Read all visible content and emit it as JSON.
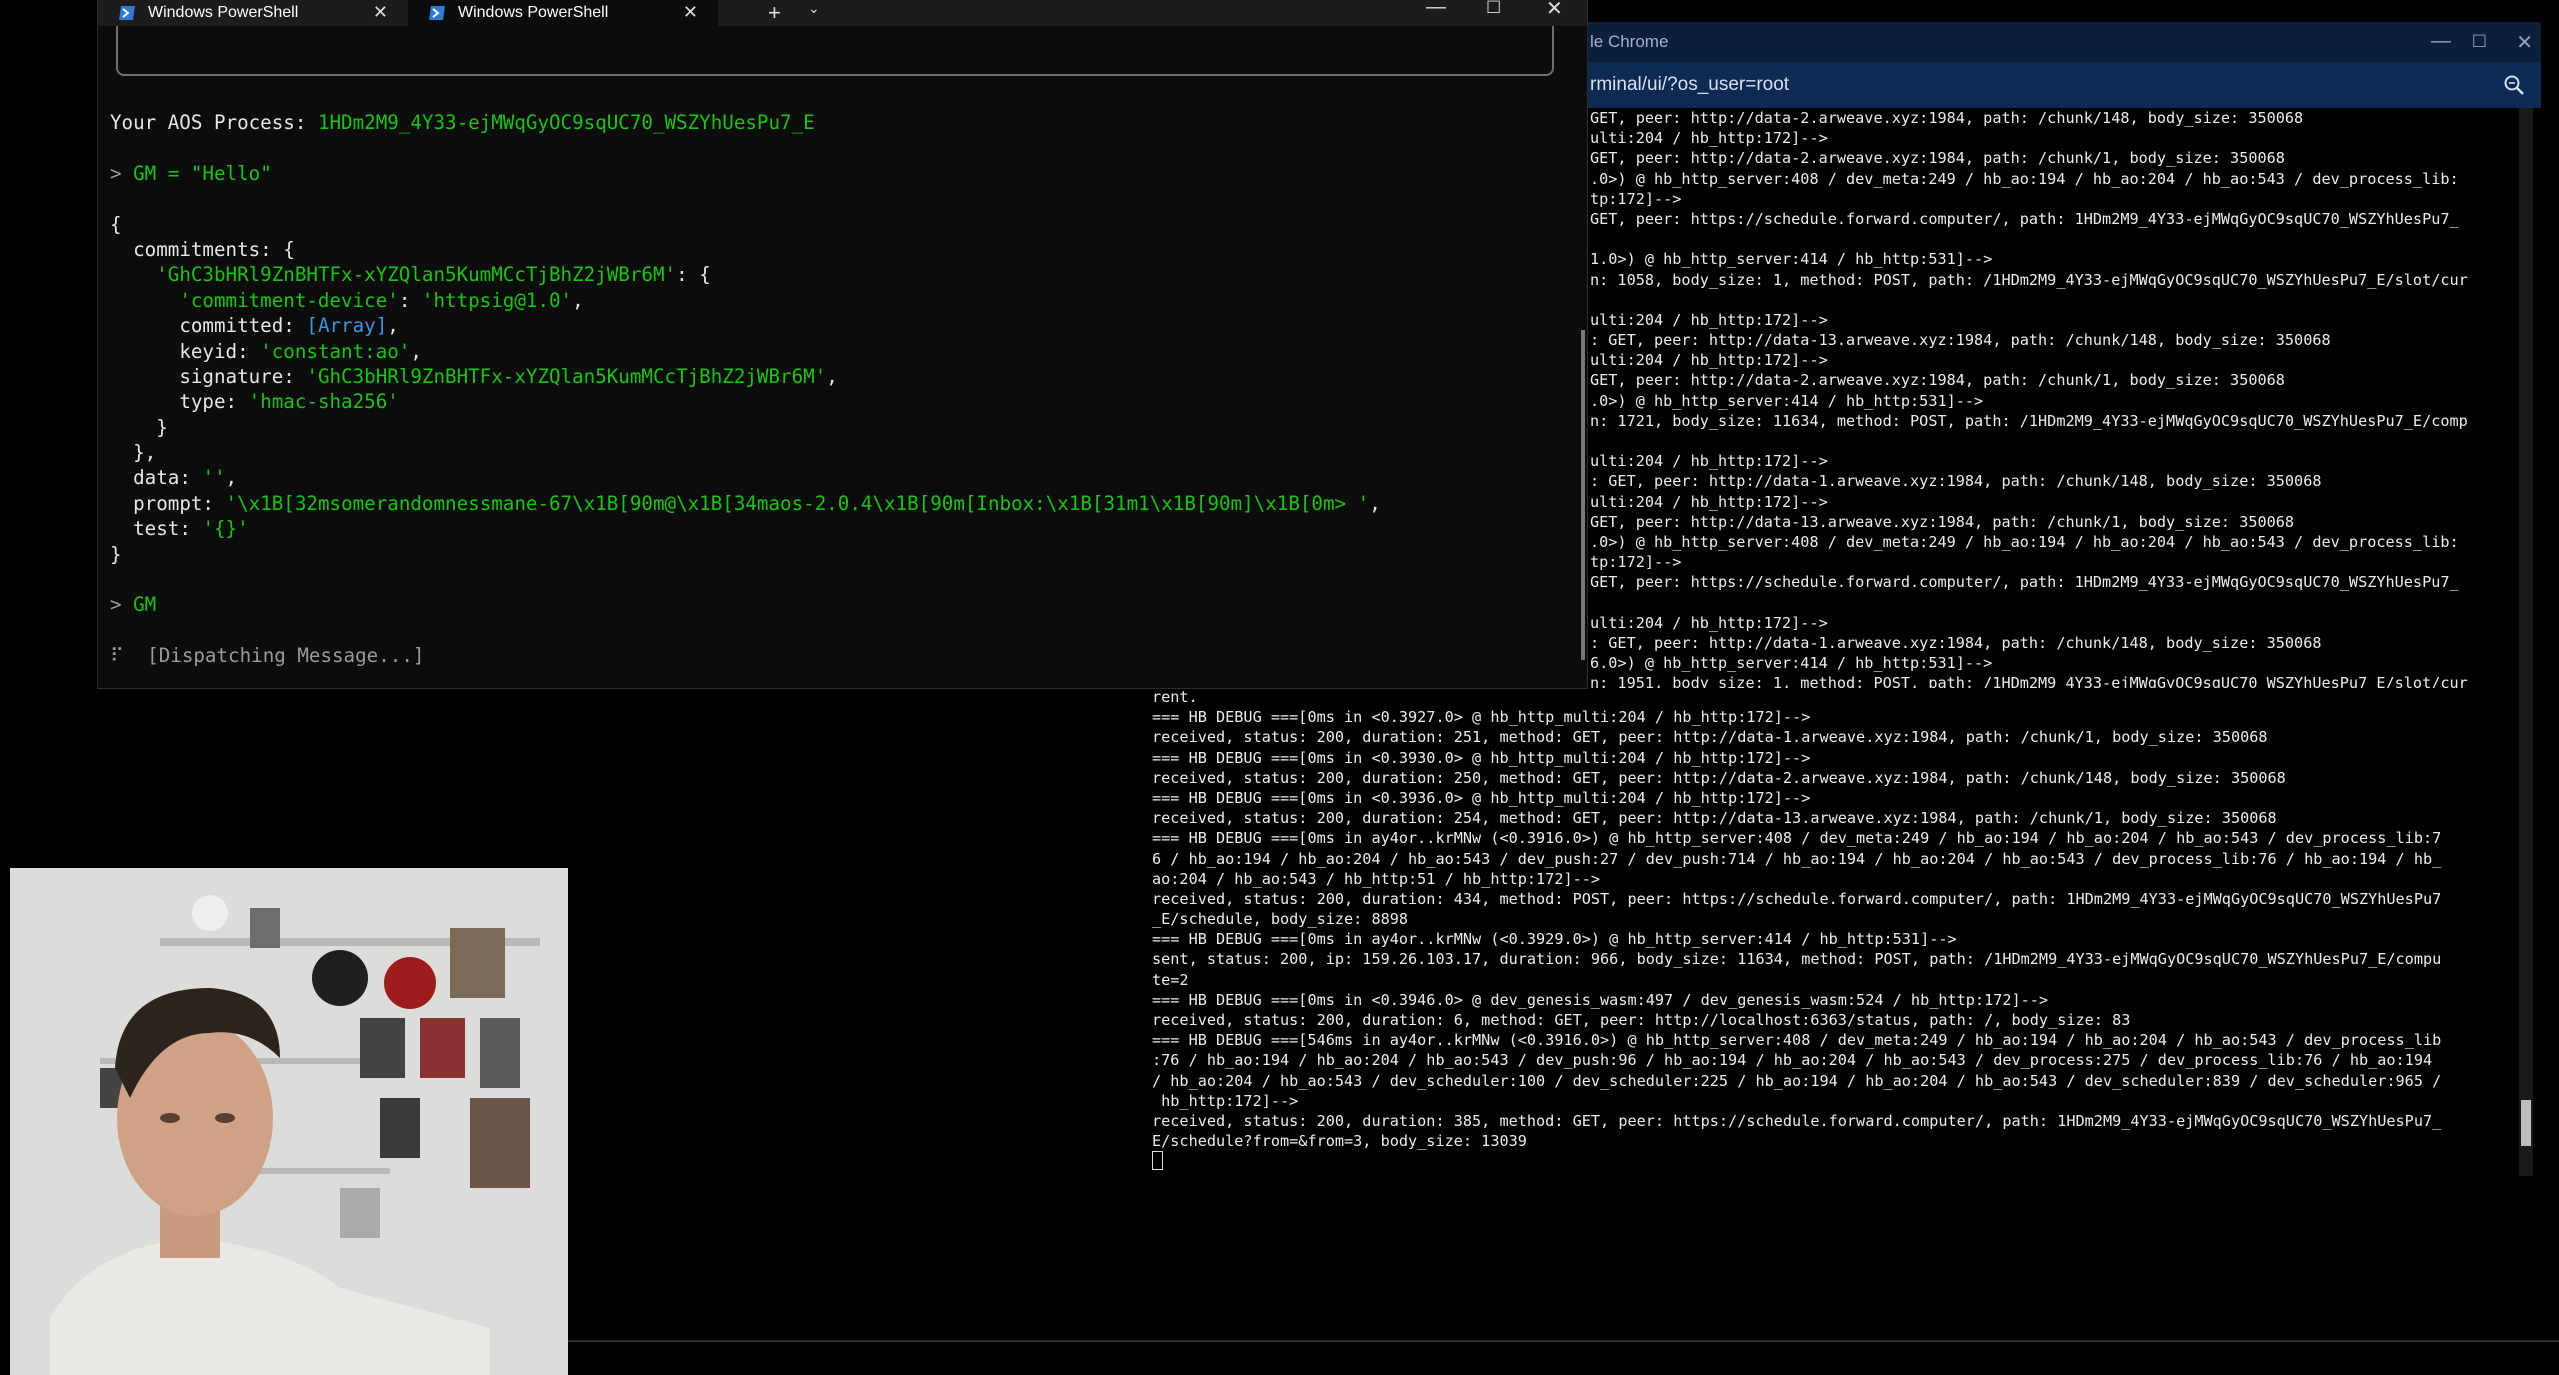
{
  "chrome": {
    "title": "le Chrome",
    "url": "rminal/ui/?os_user=root",
    "controls": {
      "minimize": "—",
      "maximize": "☐",
      "close": "✕"
    }
  },
  "log_upper": [
    "GET, peer: http://data-2.arweave.xyz:1984, path: /chunk/148, body_size: 350068",
    "ulti:204 / hb_http:172]-->",
    "GET, peer: http://data-2.arweave.xyz:1984, path: /chunk/1, body_size: 350068",
    ".0>) @ hb_http_server:408 / dev_meta:249 / hb_ao:194 / hb_ao:204 / hb_ao:543 / dev_process_lib:",
    "tp:172]-->",
    "GET, peer: https://schedule.forward.computer/, path: 1HDm2M9_4Y33-ejMWqGyOC9sqUC70_WSZYhUesPu7_",
    "",
    "1.0>) @ hb_http_server:414 / hb_http:531]-->",
    "n: 1058, body_size: 1, method: POST, path: /1HDm2M9_4Y33-ejMWqGyOC9sqUC70_WSZYhUesPu7_E/slot/cur",
    "",
    "ulti:204 / hb_http:172]-->",
    ": GET, peer: http://data-13.arweave.xyz:1984, path: /chunk/148, body_size: 350068",
    "ulti:204 / hb_http:172]-->",
    "GET, peer: http://data-2.arweave.xyz:1984, path: /chunk/1, body_size: 350068",
    ".0>) @ hb_http_server:414 / hb_http:531]-->",
    "n: 1721, body_size: 11634, method: POST, path: /1HDm2M9_4Y33-ejMWqGyOC9sqUC70_WSZYhUesPu7_E/comp",
    "",
    "ulti:204 / hb_http:172]-->",
    ": GET, peer: http://data-1.arweave.xyz:1984, path: /chunk/148, body_size: 350068",
    "ulti:204 / hb_http:172]-->",
    "GET, peer: http://data-13.arweave.xyz:1984, path: /chunk/1, body_size: 350068",
    ".0>) @ hb_http_server:408 / dev_meta:249 / hb_ao:194 / hb_ao:204 / hb_ao:543 / dev_process_lib:",
    "tp:172]-->",
    "GET, peer: https://schedule.forward.computer/, path: 1HDm2M9_4Y33-ejMWqGyOC9sqUC70_WSZYhUesPu7_",
    "",
    "ulti:204 / hb_http:172]-->",
    ": GET, peer: http://data-1.arweave.xyz:1984, path: /chunk/148, body_size: 350068",
    "6.0>) @ hb_http_server:414 / hb_http:531]-->",
    "n: 1951, body_size: 1, method: POST, path: /1HDm2M9_4Y33-ejMWqGyOC9sqUC70_WSZYhUesPu7_E/slot/cur"
  ],
  "log_lower": [
    "rent.",
    "=== HB DEBUG ===[0ms in <0.3927.0> @ hb_http_multi:204 / hb_http:172]-->",
    "received, status: 200, duration: 251, method: GET, peer: http://data-1.arweave.xyz:1984, path: /chunk/1, body_size: 350068",
    "=== HB DEBUG ===[0ms in <0.3930.0> @ hb_http_multi:204 / hb_http:172]-->",
    "received, status: 200, duration: 250, method: GET, peer: http://data-2.arweave.xyz:1984, path: /chunk/148, body_size: 350068",
    "=== HB DEBUG ===[0ms in <0.3936.0> @ hb_http_multi:204 / hb_http:172]-->",
    "received, status: 200, duration: 254, method: GET, peer: http://data-13.arweave.xyz:1984, path: /chunk/1, body_size: 350068",
    "=== HB DEBUG ===[0ms in ay4or..krMNw (<0.3916.0>) @ hb_http_server:408 / dev_meta:249 / hb_ao:194 / hb_ao:204 / hb_ao:543 / dev_process_lib:7",
    "6 / hb_ao:194 / hb_ao:204 / hb_ao:543 / dev_push:27 / dev_push:714 / hb_ao:194 / hb_ao:204 / hb_ao:543 / dev_process_lib:76 / hb_ao:194 / hb_",
    "ao:204 / hb_ao:543 / hb_http:51 / hb_http:172]-->",
    "received, status: 200, duration: 434, method: POST, peer: https://schedule.forward.computer/, path: 1HDm2M9_4Y33-ejMWqGyOC9sqUC70_WSZYhUesPu7",
    "_E/schedule, body_size: 8898",
    "=== HB DEBUG ===[0ms in ay4or..krMNw (<0.3929.0>) @ hb_http_server:414 / hb_http:531]-->",
    "sent, status: 200, ip: 159.26.103.17, duration: 966, body_size: 11634, method: POST, path: /1HDm2M9_4Y33-ejMWqGyOC9sqUC70_WSZYhUesPu7_E/compu",
    "te=2",
    "=== HB DEBUG ===[0ms in <0.3946.0> @ dev_genesis_wasm:497 / dev_genesis_wasm:524 / hb_http:172]-->",
    "received, status: 200, duration: 6, method: GET, peer: http://localhost:6363/status, path: /, body_size: 83",
    "=== HB DEBUG ===[546ms in ay4or..krMNw (<0.3916.0>) @ hb_http_server:408 / dev_meta:249 / hb_ao:194 / hb_ao:204 / hb_ao:543 / dev_process_lib",
    ":76 / hb_ao:194 / hb_ao:204 / hb_ao:543 / dev_push:96 / hb_ao:194 / hb_ao:204 / hb_ao:543 / dev_process:275 / dev_process_lib:76 / hb_ao:194",
    "/ hb_ao:204 / hb_ao:543 / dev_scheduler:100 / dev_scheduler:225 / hb_ao:194 / hb_ao:204 / hb_ao:543 / dev_scheduler:839 / dev_scheduler:965 /",
    " hb_http:172]-->",
    "received, status: 200, duration: 385, method: GET, peer: https://schedule.forward.computer/, path: 1HDm2M9_4Y33-ejMWqGyOC9sqUC70_WSZYhUesPu7_",
    "E/schedule?from=&from=3, body_size: 13039"
  ],
  "powershell": {
    "tabs": [
      {
        "label": "Windows PowerShell",
        "close": "✕"
      },
      {
        "label": "Windows PowerShell",
        "close": "✕"
      }
    ],
    "new_tab": "+",
    "dropdown": "⌄",
    "controls": {
      "minimize": "—",
      "maximize": "☐",
      "close": "✕"
    },
    "process_label": "Your AOS Process:",
    "process_id": "1HDm2M9_4Y33-ejMWqGyOC9sqUC70_WSZYhUesPu7_E",
    "prompt_symbol": ">",
    "command_1": "GM = \"Hello\"",
    "output": {
      "open_brace": "{",
      "commitments_key": "commitments: {",
      "commit_id_key": "'GhC3bHRl9ZnBHTFx-xYZQlan5KumMCcTjBhZ2jWBr6M'",
      "commit_id_open": ": {",
      "device_key": "'commitment-device'",
      "device_val": "'httpsig@1.0'",
      "committed_key": "committed:",
      "committed_val": "[Array]",
      "keyid_key": "keyid:",
      "keyid_val": "'constant:ao'",
      "signature_key": "signature:",
      "signature_val": "'GhC3bHRl9ZnBHTFx-xYZQlan5KumMCcTjBhZ2jWBr6M'",
      "type_key": "type:",
      "type_val": "'hmac-sha256'",
      "close_inner": "}",
      "close_commit": "},",
      "data_key": "data:",
      "data_val": "''",
      "prompt_key": "prompt:",
      "prompt_val": "'\\x1B[32msomerandomnessmane-67\\x1B[90m@\\x1B[34maos-2.0.4\\x1B[90m[Inbox:\\x1B[31m1\\x1B[90m]\\x1B[0m> '",
      "test_key": "test:",
      "test_val": "'{}'",
      "close_brace": "}"
    },
    "command_2": "GM",
    "spinner": "⠏",
    "dispatching": "[Dispatching Message...]"
  }
}
